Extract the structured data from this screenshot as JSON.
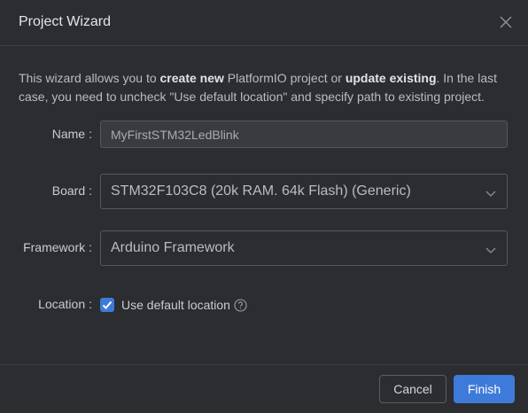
{
  "dialog": {
    "title": "Project Wizard",
    "close_icon": "close-icon"
  },
  "intro": {
    "p1": "This wizard allows you to ",
    "b1": "create new",
    "p2": " PlatformIO project or ",
    "b2": "update existing",
    "p3": ". In the last case, you need to uncheck \"Use default location\" and specify path to existing project."
  },
  "form": {
    "name": {
      "label": "Name",
      "colon": ":",
      "value": "MyFirstSTM32LedBlink"
    },
    "board": {
      "label": "Board",
      "colon": ":",
      "value": "STM32F103C8 (20k RAM. 64k Flash) (Generic)",
      "icon": "chevron-down-icon"
    },
    "framework": {
      "label": "Framework",
      "colon": ":",
      "value": "Arduino Framework",
      "icon": "chevron-down-icon"
    },
    "location": {
      "label": "Location",
      "colon": ":",
      "checkbox_label": "Use default location",
      "checked": true,
      "help_icon": "help-circle-icon"
    }
  },
  "footer": {
    "cancel_label": "Cancel",
    "finish_label": "Finish"
  },
  "colors": {
    "background": "#2b2d30",
    "accent": "#3e7ad9",
    "border": "#55585e"
  }
}
